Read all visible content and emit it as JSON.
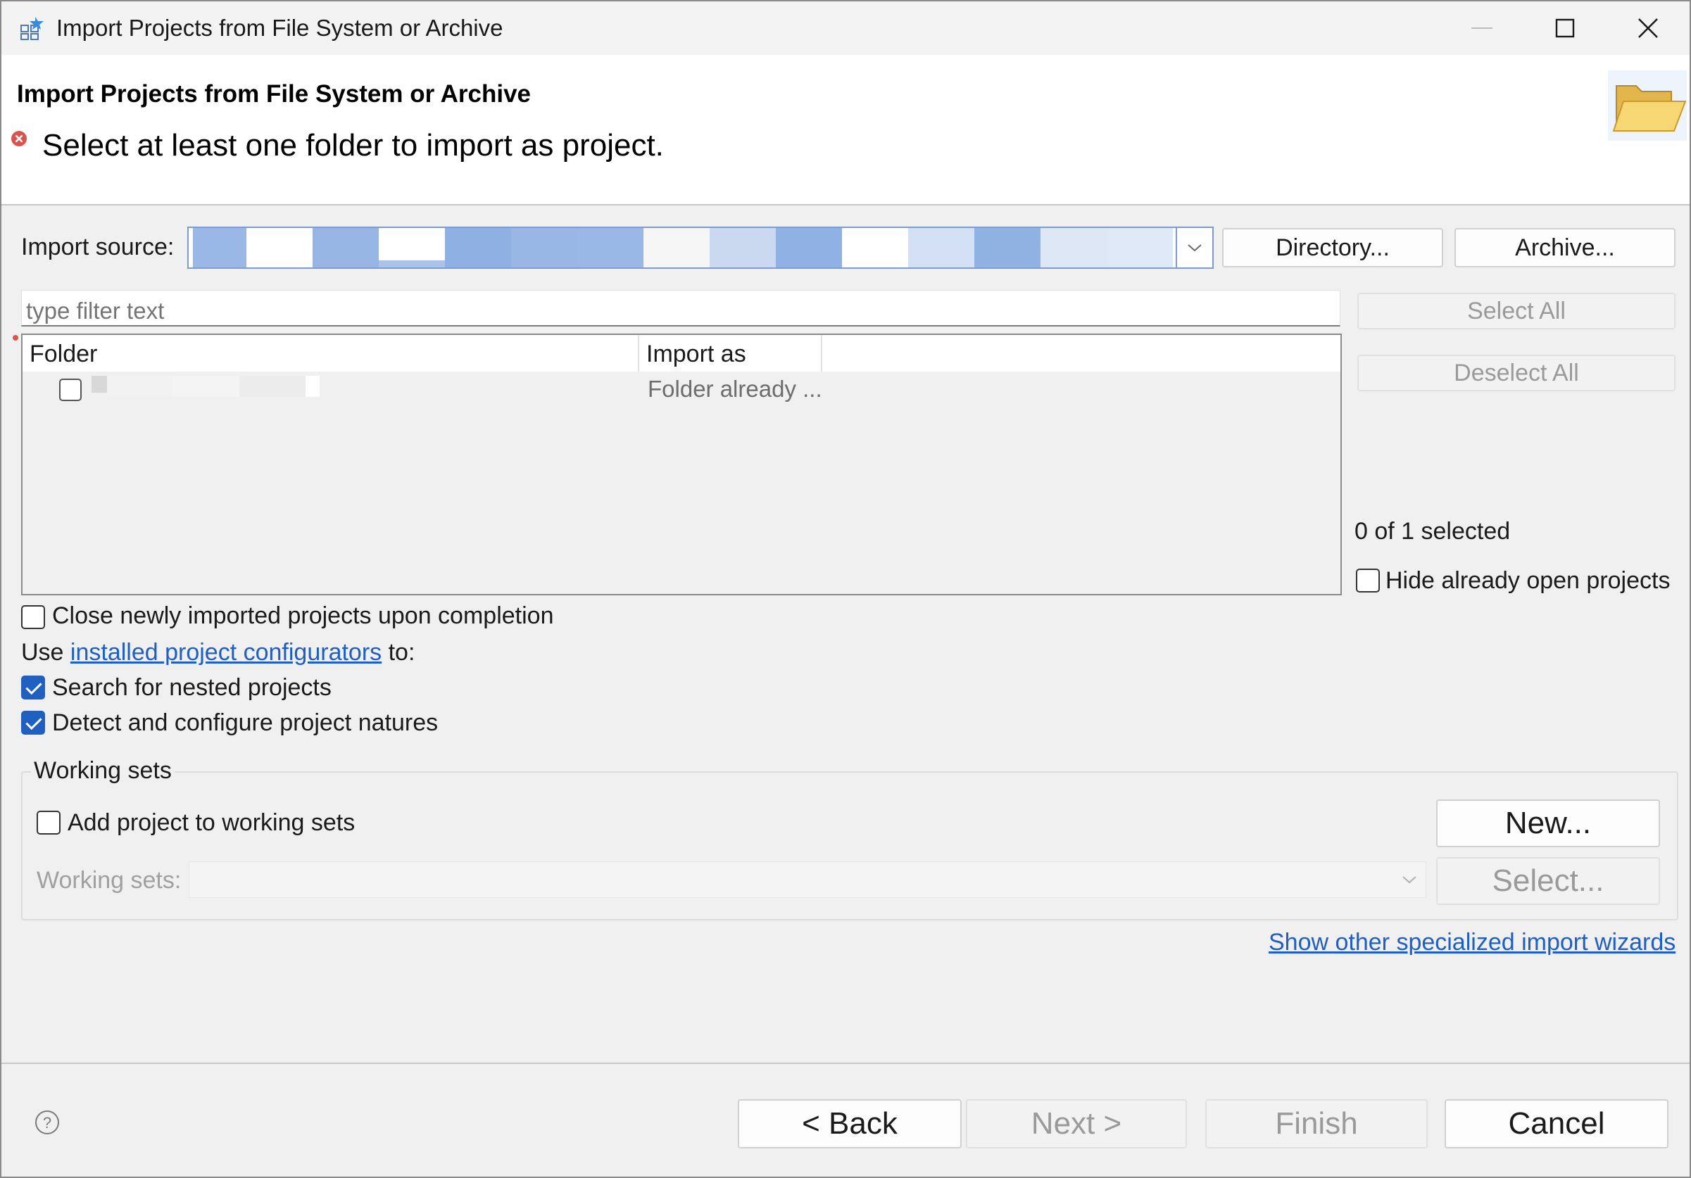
{
  "window": {
    "title": "Import Projects from File System or Archive",
    "controls": {
      "minimize": "minimize-icon",
      "maximize": "maximize-icon",
      "close": "close-icon"
    }
  },
  "header": {
    "title": "Import Projects from File System or Archive",
    "message": "Select at least one folder to import as project.",
    "message_icon": "error-icon",
    "banner_icon": "folder-icon"
  },
  "source": {
    "label": "Import source:",
    "directory_button": "Directory...",
    "archive_button": "Archive..."
  },
  "filter": {
    "placeholder": "type filter text"
  },
  "selection_buttons": {
    "select_all": "Select All",
    "deselect_all": "Deselect All"
  },
  "table": {
    "columns": [
      "Folder",
      "Import as"
    ],
    "rows": [
      {
        "checked": false,
        "import_as": "Folder already ..."
      }
    ]
  },
  "status": {
    "selected_count": "0 of 1 selected"
  },
  "options": {
    "hide_open_projects": {
      "label": "Hide already open projects",
      "checked": false
    },
    "close_after_import": {
      "label": "Close newly imported projects upon completion",
      "checked": false
    },
    "use_prefix": "Use",
    "configurators_link": "installed project configurators",
    "use_suffix": "to:",
    "search_nested": {
      "label": "Search for nested projects",
      "checked": true
    },
    "detect_natures": {
      "label": "Detect and configure project natures",
      "checked": true
    }
  },
  "working_sets": {
    "group_title": "Working sets",
    "add_to_sets": {
      "label": "Add project to working sets",
      "checked": false
    },
    "new_button": "New...",
    "sets_label": "Working sets:",
    "select_button": "Select..."
  },
  "specialized_link": "Show other specialized import wizards",
  "footer": {
    "back": "< Back",
    "next": "Next >",
    "finish": "Finish",
    "cancel": "Cancel"
  },
  "colors": {
    "accent": "#1f5fbf",
    "link": "#1f5fc4",
    "error": "#d9534f",
    "dialog_bg": "#f0f0f0"
  }
}
